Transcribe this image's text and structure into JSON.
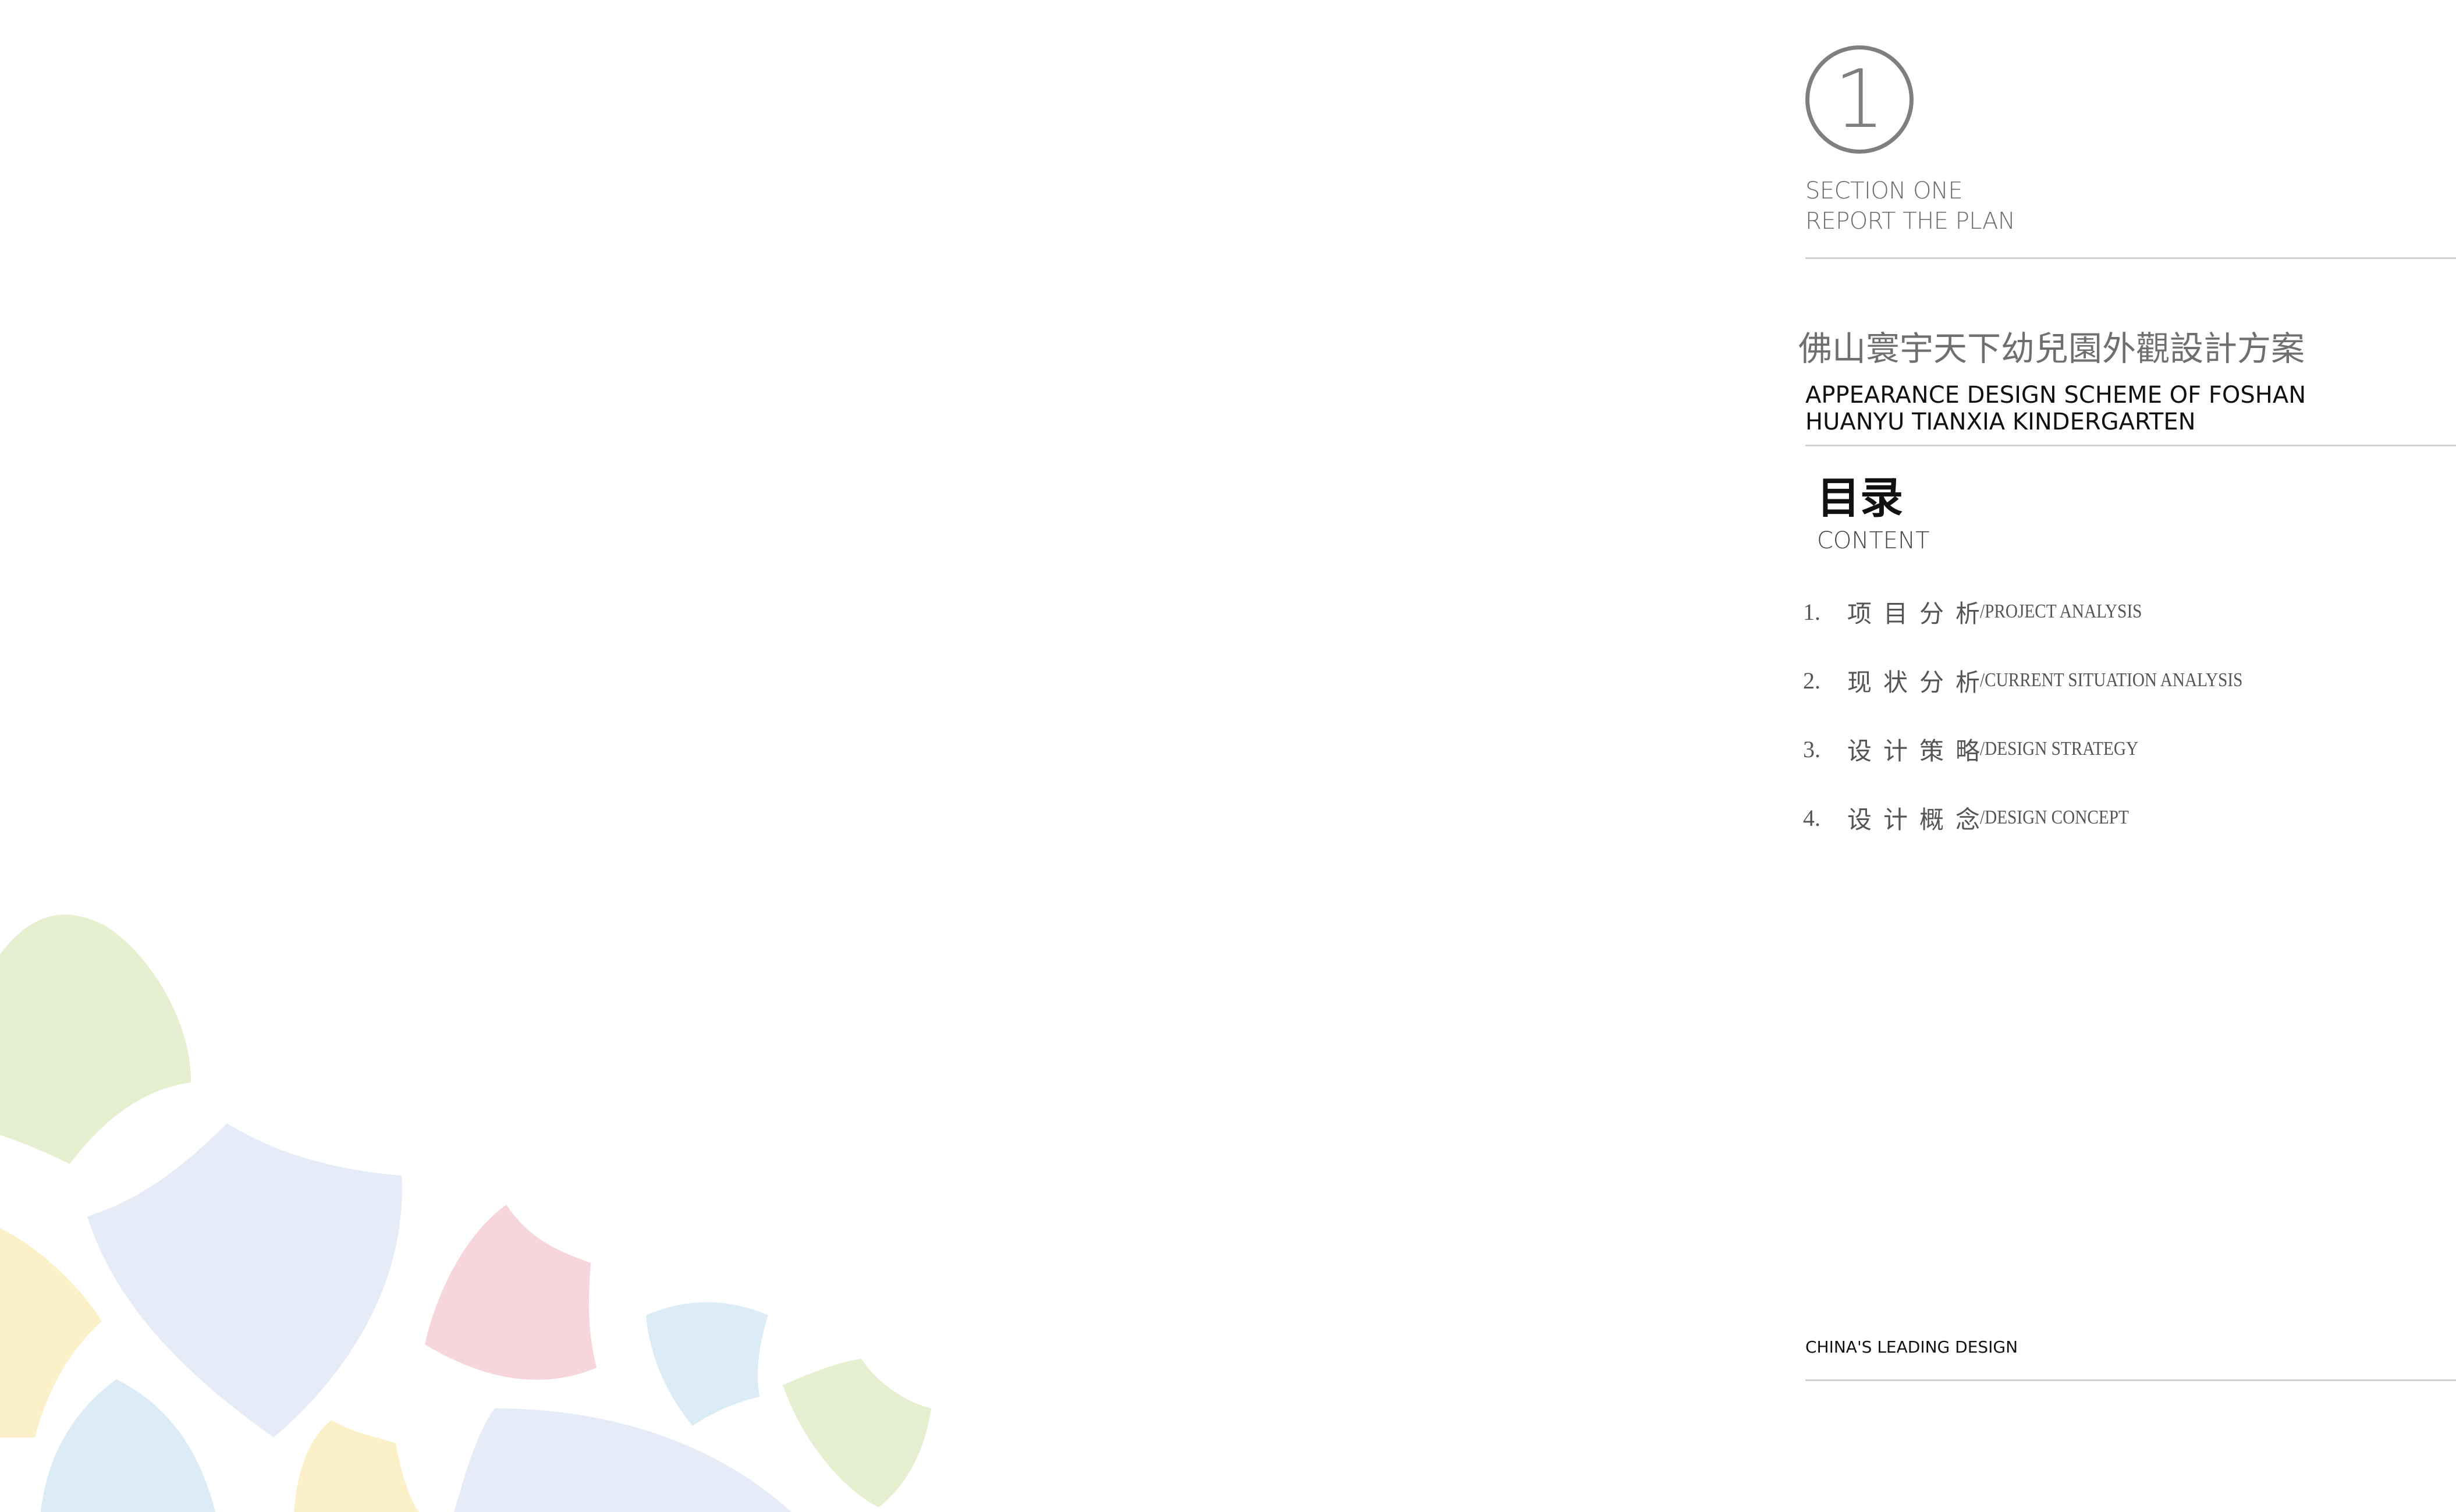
{
  "section": {
    "number": "1",
    "line1": "SECTION ONE",
    "line2": "REPORT THE PLAN"
  },
  "project": {
    "title_cn": "佛山寰宇天下幼兒園外觀設計方案",
    "title_en_line1": "APPEARANCE DESIGN SCHEME OF FOSHAN",
    "title_en_line2": "HUANYU TIANXIA KINDERGARTEN"
  },
  "toc": {
    "heading": "目录",
    "subheading": "CONTENT",
    "items": [
      {
        "num": "1.",
        "cn": "项目分析",
        "en": "/PROJECT ANALYSIS"
      },
      {
        "num": "2.",
        "cn": "现状分析",
        "en": "/CURRENT SITUATION ANALYSIS"
      },
      {
        "num": "3.",
        "cn": "设计策略",
        "en": "/DESIGN STRATEGY"
      },
      {
        "num": "4.",
        "cn": "设计概念",
        "en": "/DESIGN CONCEPT"
      }
    ]
  },
  "footer": {
    "tagline": "CHINA'S LEADING DESIGN"
  },
  "colors": {
    "petal_green": "#e6f0d0",
    "petal_blue": "#e5ecf7",
    "petal_yellow": "#fcf0c8",
    "petal_pink": "#f6d5db",
    "petal_sky": "#dcecf7",
    "rule": "#d3d3d3"
  }
}
